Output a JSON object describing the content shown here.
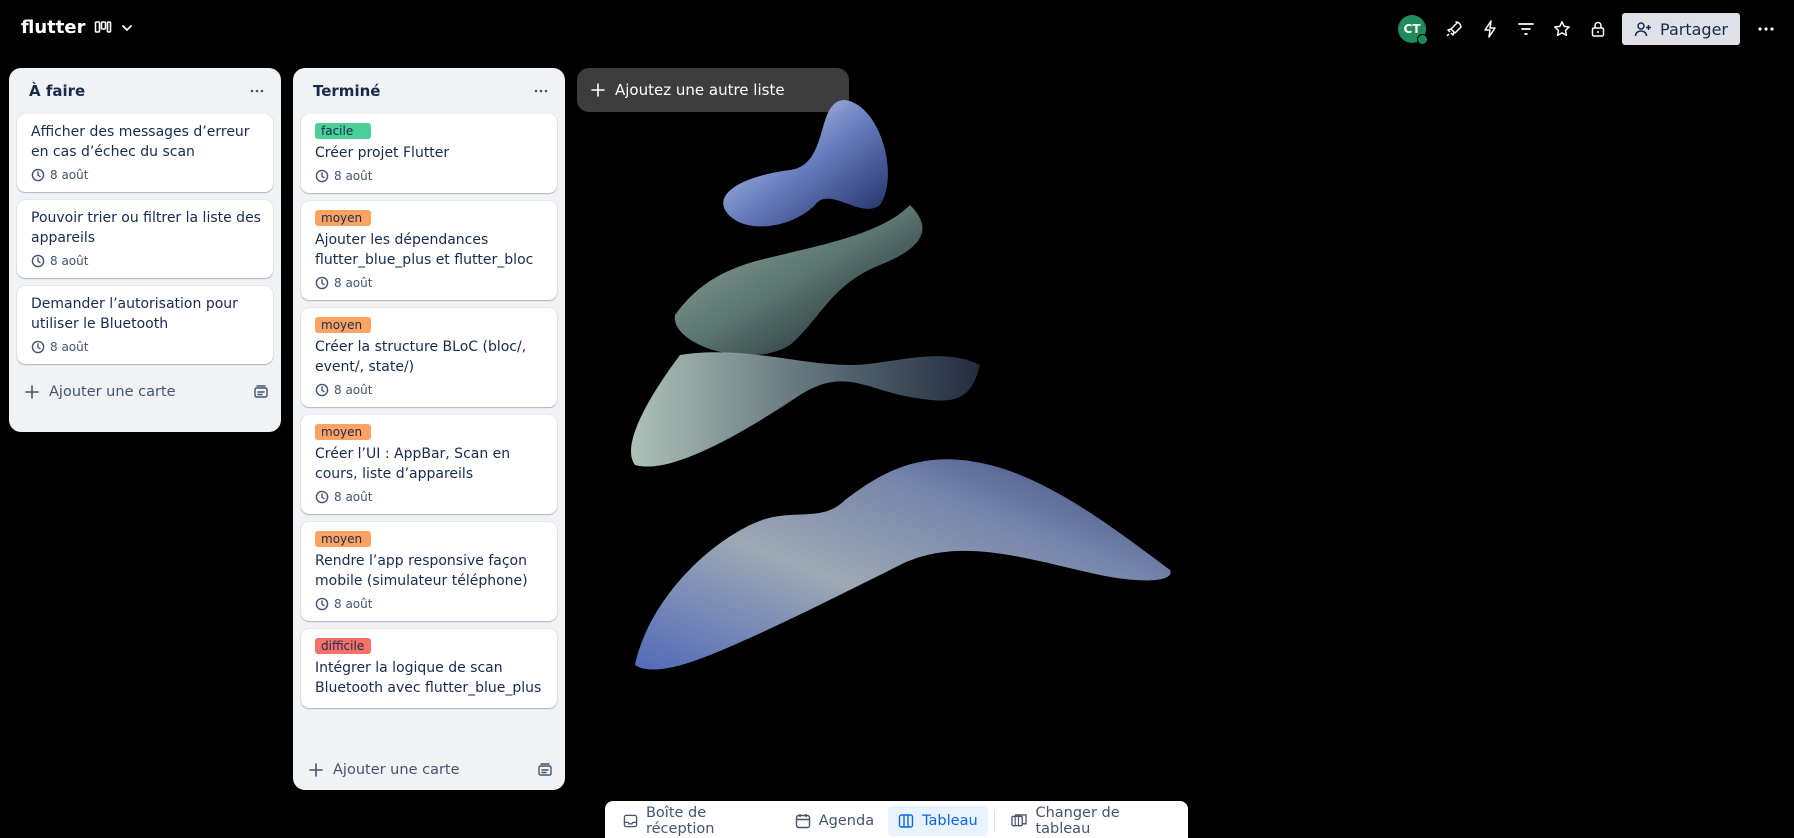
{
  "header": {
    "board_title": "flutter",
    "avatar_initials": "CT",
    "share_label": "Partager",
    "icons": [
      "board-view-icon",
      "chevron-down-icon",
      "power-ups-icon",
      "automation-icon",
      "filter-icon",
      "star-icon",
      "visibility-lock-icon",
      "more-icon"
    ]
  },
  "lists": [
    {
      "title": "À faire",
      "add_card": "Ajouter une carte",
      "cards": [
        {
          "title": "Afficher des messages d’erreur en cas d’échec du scan",
          "due": "8 août"
        },
        {
          "title": "Pouvoir trier ou filtrer la liste des appareils",
          "due": "8 août"
        },
        {
          "title": "Demander l’autorisation pour utiliser le Bluetooth",
          "due": "8 août"
        }
      ]
    },
    {
      "title": "Terminé",
      "add_card": "Ajouter une carte",
      "cards": [
        {
          "label": "facile",
          "label_color": "#4bce97",
          "title": "Créer projet Flutter",
          "due": "8 août"
        },
        {
          "label": "moyen",
          "label_color": "#fea362",
          "title": "Ajouter les dépendances flutter_blue_plus et flutter_bloc",
          "due": "8 août"
        },
        {
          "label": "moyen",
          "label_color": "#fea362",
          "title": "Créer la structure BLoC (bloc/, event/, state/)",
          "due": "8 août"
        },
        {
          "label": "moyen",
          "label_color": "#fea362",
          "title": "Créer l’UI : AppBar, Scan en cours, liste d’appareils",
          "due": "8 août"
        },
        {
          "label": "moyen",
          "label_color": "#fea362",
          "title": "Rendre l’app responsive façon mobile (simulateur téléphone)",
          "due": "8 août"
        },
        {
          "label": "difficile",
          "label_color": "#f87168",
          "title": "Intégrer la logique de scan Bluetooth avec flutter_blue_plus"
        }
      ]
    }
  ],
  "add_list_label": "Ajoutez une autre liste",
  "bottom_nav": {
    "inbox": "Boîte de réception",
    "planner": "Agenda",
    "board": "Tableau",
    "switch_board": "Changer de tableau",
    "active": "board"
  },
  "colors": {
    "background": "#000000",
    "list_bg": "#f1f2f4",
    "avatar": "#1f8a5b",
    "active_nav": "#0c66e4"
  }
}
